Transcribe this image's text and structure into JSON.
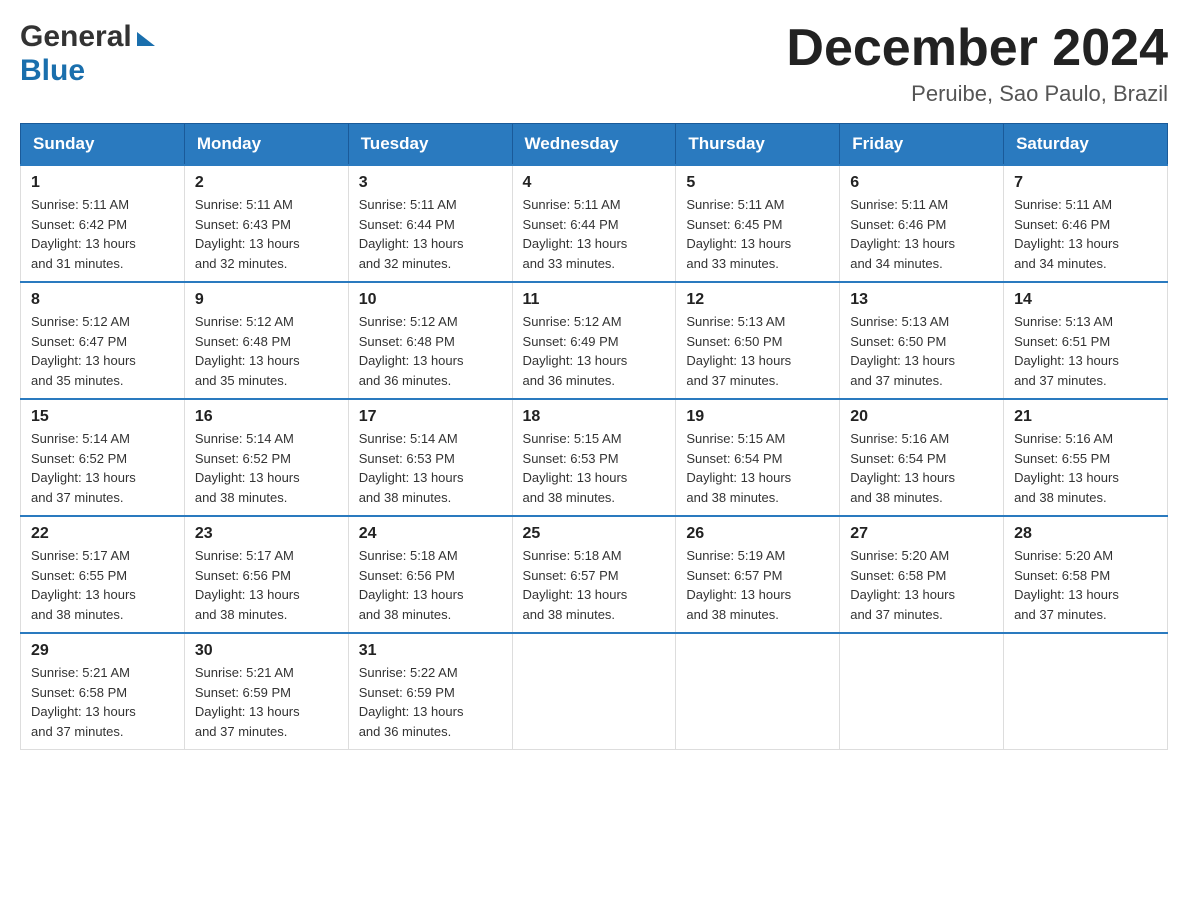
{
  "header": {
    "logo_general": "General",
    "logo_blue": "Blue",
    "month_title": "December 2024",
    "location": "Peruibe, Sao Paulo, Brazil"
  },
  "weekdays": [
    "Sunday",
    "Monday",
    "Tuesday",
    "Wednesday",
    "Thursday",
    "Friday",
    "Saturday"
  ],
  "weeks": [
    [
      {
        "day": "1",
        "info": "Sunrise: 5:11 AM\nSunset: 6:42 PM\nDaylight: 13 hours\nand 31 minutes."
      },
      {
        "day": "2",
        "info": "Sunrise: 5:11 AM\nSunset: 6:43 PM\nDaylight: 13 hours\nand 32 minutes."
      },
      {
        "day": "3",
        "info": "Sunrise: 5:11 AM\nSunset: 6:44 PM\nDaylight: 13 hours\nand 32 minutes."
      },
      {
        "day": "4",
        "info": "Sunrise: 5:11 AM\nSunset: 6:44 PM\nDaylight: 13 hours\nand 33 minutes."
      },
      {
        "day": "5",
        "info": "Sunrise: 5:11 AM\nSunset: 6:45 PM\nDaylight: 13 hours\nand 33 minutes."
      },
      {
        "day": "6",
        "info": "Sunrise: 5:11 AM\nSunset: 6:46 PM\nDaylight: 13 hours\nand 34 minutes."
      },
      {
        "day": "7",
        "info": "Sunrise: 5:11 AM\nSunset: 6:46 PM\nDaylight: 13 hours\nand 34 minutes."
      }
    ],
    [
      {
        "day": "8",
        "info": "Sunrise: 5:12 AM\nSunset: 6:47 PM\nDaylight: 13 hours\nand 35 minutes."
      },
      {
        "day": "9",
        "info": "Sunrise: 5:12 AM\nSunset: 6:48 PM\nDaylight: 13 hours\nand 35 minutes."
      },
      {
        "day": "10",
        "info": "Sunrise: 5:12 AM\nSunset: 6:48 PM\nDaylight: 13 hours\nand 36 minutes."
      },
      {
        "day": "11",
        "info": "Sunrise: 5:12 AM\nSunset: 6:49 PM\nDaylight: 13 hours\nand 36 minutes."
      },
      {
        "day": "12",
        "info": "Sunrise: 5:13 AM\nSunset: 6:50 PM\nDaylight: 13 hours\nand 37 minutes."
      },
      {
        "day": "13",
        "info": "Sunrise: 5:13 AM\nSunset: 6:50 PM\nDaylight: 13 hours\nand 37 minutes."
      },
      {
        "day": "14",
        "info": "Sunrise: 5:13 AM\nSunset: 6:51 PM\nDaylight: 13 hours\nand 37 minutes."
      }
    ],
    [
      {
        "day": "15",
        "info": "Sunrise: 5:14 AM\nSunset: 6:52 PM\nDaylight: 13 hours\nand 37 minutes."
      },
      {
        "day": "16",
        "info": "Sunrise: 5:14 AM\nSunset: 6:52 PM\nDaylight: 13 hours\nand 38 minutes."
      },
      {
        "day": "17",
        "info": "Sunrise: 5:14 AM\nSunset: 6:53 PM\nDaylight: 13 hours\nand 38 minutes."
      },
      {
        "day": "18",
        "info": "Sunrise: 5:15 AM\nSunset: 6:53 PM\nDaylight: 13 hours\nand 38 minutes."
      },
      {
        "day": "19",
        "info": "Sunrise: 5:15 AM\nSunset: 6:54 PM\nDaylight: 13 hours\nand 38 minutes."
      },
      {
        "day": "20",
        "info": "Sunrise: 5:16 AM\nSunset: 6:54 PM\nDaylight: 13 hours\nand 38 minutes."
      },
      {
        "day": "21",
        "info": "Sunrise: 5:16 AM\nSunset: 6:55 PM\nDaylight: 13 hours\nand 38 minutes."
      }
    ],
    [
      {
        "day": "22",
        "info": "Sunrise: 5:17 AM\nSunset: 6:55 PM\nDaylight: 13 hours\nand 38 minutes."
      },
      {
        "day": "23",
        "info": "Sunrise: 5:17 AM\nSunset: 6:56 PM\nDaylight: 13 hours\nand 38 minutes."
      },
      {
        "day": "24",
        "info": "Sunrise: 5:18 AM\nSunset: 6:56 PM\nDaylight: 13 hours\nand 38 minutes."
      },
      {
        "day": "25",
        "info": "Sunrise: 5:18 AM\nSunset: 6:57 PM\nDaylight: 13 hours\nand 38 minutes."
      },
      {
        "day": "26",
        "info": "Sunrise: 5:19 AM\nSunset: 6:57 PM\nDaylight: 13 hours\nand 38 minutes."
      },
      {
        "day": "27",
        "info": "Sunrise: 5:20 AM\nSunset: 6:58 PM\nDaylight: 13 hours\nand 37 minutes."
      },
      {
        "day": "28",
        "info": "Sunrise: 5:20 AM\nSunset: 6:58 PM\nDaylight: 13 hours\nand 37 minutes."
      }
    ],
    [
      {
        "day": "29",
        "info": "Sunrise: 5:21 AM\nSunset: 6:58 PM\nDaylight: 13 hours\nand 37 minutes."
      },
      {
        "day": "30",
        "info": "Sunrise: 5:21 AM\nSunset: 6:59 PM\nDaylight: 13 hours\nand 37 minutes."
      },
      {
        "day": "31",
        "info": "Sunrise: 5:22 AM\nSunset: 6:59 PM\nDaylight: 13 hours\nand 36 minutes."
      },
      {
        "day": "",
        "info": ""
      },
      {
        "day": "",
        "info": ""
      },
      {
        "day": "",
        "info": ""
      },
      {
        "day": "",
        "info": ""
      }
    ]
  ]
}
